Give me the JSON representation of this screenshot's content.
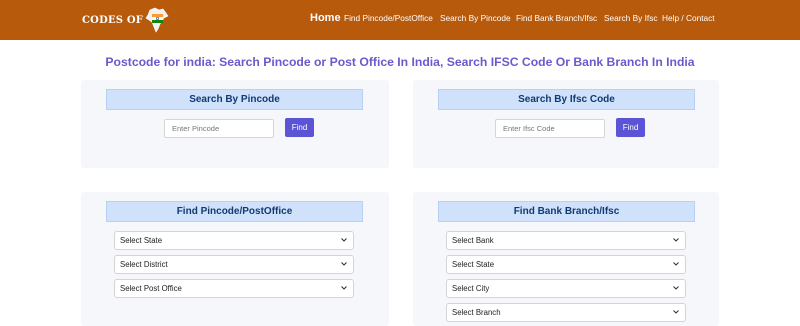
{
  "brand": {
    "text": "CODES OF",
    "logo_icon": "india-map-flag-icon"
  },
  "nav": {
    "home": "Home",
    "items": [
      "Find Pincode/PostOffice",
      "Search By Pincode",
      "Find Bank Branch/Ifsc",
      "Search By Ifsc",
      "Help / Contact"
    ]
  },
  "page_title": "Postcode for india: Search Pincode or Post Office In India, Search IFSC Code Or Bank Branch In India",
  "search_pincode": {
    "heading": "Search By Pincode",
    "placeholder": "Enter Pincode",
    "button": "Find"
  },
  "search_ifsc": {
    "heading": "Search By Ifsc Code",
    "placeholder": "Enter Ifsc Code",
    "button": "Find"
  },
  "find_pincode": {
    "heading": "Find Pincode/PostOffice",
    "selects": [
      "Select State",
      "Select District",
      "Select Post Office"
    ]
  },
  "find_bank": {
    "heading": "Find Bank Branch/Ifsc",
    "selects": [
      "Select Bank",
      "Select State",
      "Select City",
      "Select Branch"
    ]
  },
  "colors": {
    "header": "#b85a0c",
    "accent": "#5b55d6",
    "title": "#6a5acd",
    "heading_bg": "#cfe1fb"
  }
}
